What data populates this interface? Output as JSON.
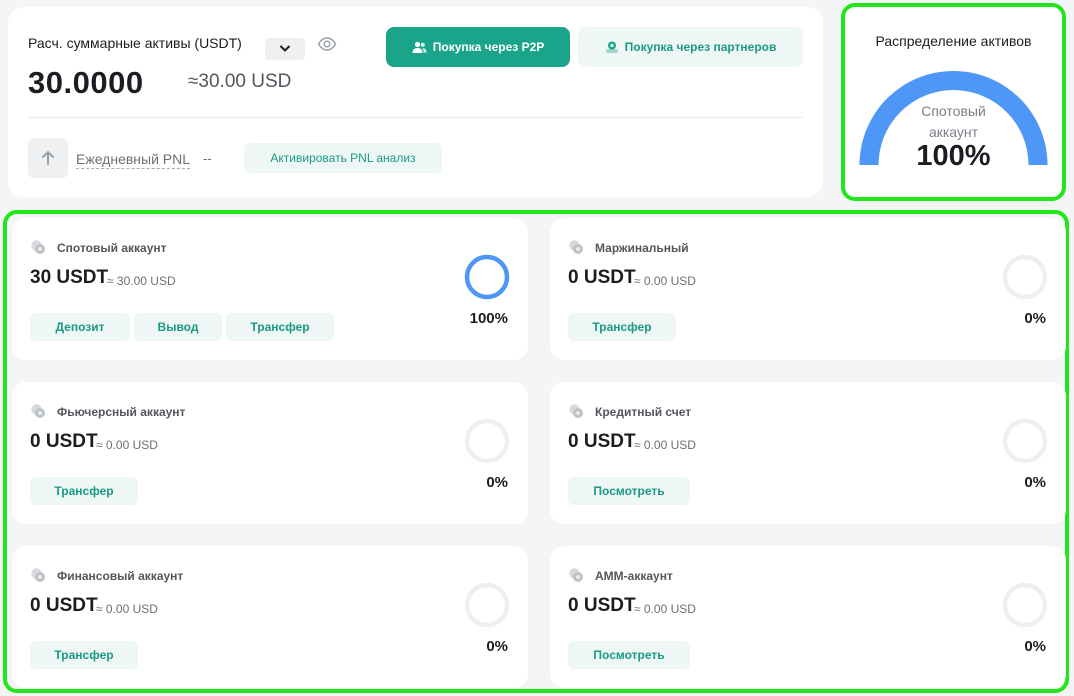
{
  "summary": {
    "label": "Расч. суммарные активы (USDT)",
    "currency_dropdown_icon": "chevron-down-icon",
    "visibility_icon": "eye-icon",
    "total": "30.0000",
    "approx": "≈30.00 USD",
    "btn_p2p": "Покупка через P2P",
    "btn_partner": "Покупка через партнеров",
    "pnl_label": "Ежедневный PNL",
    "pnl_value": "--",
    "btn_pnl": "Активировать PNL анализ"
  },
  "distribution": {
    "title": "Распределение активов",
    "label_line1": "Спотовый",
    "label_line2": "аккаунт",
    "percent": "100%",
    "fraction": 1,
    "color": "#4f97f7"
  },
  "accounts": [
    {
      "name": "Спотовый аккаунт",
      "balance": "30 USDT",
      "usd": "≈ 30.00 USD",
      "percent": "100%",
      "fraction": 1,
      "icon": "coins-icon",
      "buttons": [
        "Депозит",
        "Вывод",
        "Трансфер"
      ]
    },
    {
      "name": "Маржинальный",
      "balance": "0 USDT",
      "usd": "≈ 0.00 USD",
      "percent": "0%",
      "fraction": 0,
      "icon": "percent-icon",
      "buttons": [
        "Трансфер"
      ]
    },
    {
      "name": "Фьючерсный аккаунт",
      "balance": "0 USDT",
      "usd": "≈ 0.00 USD",
      "percent": "0%",
      "fraction": 0,
      "icon": "document-icon",
      "buttons": [
        "Трансфер"
      ]
    },
    {
      "name": "Кредитный счет",
      "balance": "0 USDT",
      "usd": "≈ 0.00 USD",
      "percent": "0%",
      "fraction": 0,
      "icon": "credit-icon",
      "buttons": [
        "Посмотреть"
      ]
    },
    {
      "name": "Финансовый аккаунт",
      "balance": "0 USDT",
      "usd": "≈ 0.00 USD",
      "percent": "0%",
      "fraction": 0,
      "icon": "user-icon",
      "buttons": [
        "Трансфер"
      ]
    },
    {
      "name": "АММ-аккаунт",
      "balance": "0 USDT",
      "usd": "≈ 0.00 USD",
      "percent": "0%",
      "fraction": 0,
      "icon": "monitor-icon",
      "buttons": [
        "Посмотреть"
      ]
    }
  ],
  "colors": {
    "accent": "#1aa58b",
    "ring_active": "#4f97f7",
    "ring_empty": "#eeeff1",
    "highlight": "#22e61a"
  }
}
